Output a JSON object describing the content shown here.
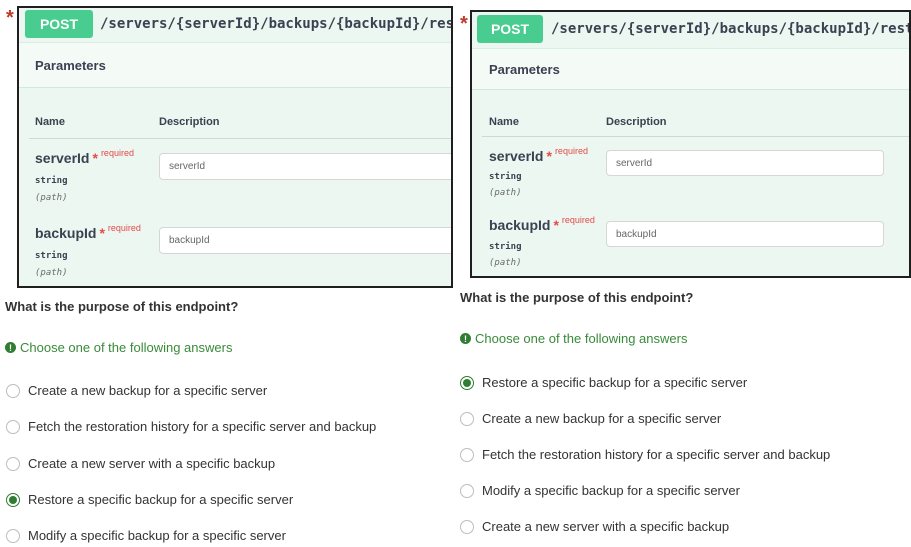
{
  "colors": {
    "post": "#49cc90",
    "required": "#e64a4a",
    "hint": "#3a8a3a",
    "selected_radio": "#2e7d32"
  },
  "icons": {
    "hint": "exclamation-circle-icon",
    "marker": "asterisk-icon"
  },
  "left": {
    "marker": "*",
    "method": "POST",
    "path": "/servers/{serverId}/backups/{backupId}/restore",
    "parameters_title": "Parameters",
    "col_name": "Name",
    "col_description": "Description",
    "params": [
      {
        "name": "serverId",
        "star": "*",
        "required": "required",
        "type": "string",
        "in": "(path)",
        "placeholder": "serverId"
      },
      {
        "name": "backupId",
        "star": "*",
        "required": "required",
        "type": "string",
        "in": "(path)",
        "placeholder": "backupId"
      }
    ],
    "question": "What is the purpose of this endpoint?",
    "hint": "Choose one of the following answers",
    "options": [
      {
        "label": "Create a new backup for a specific server",
        "selected": false
      },
      {
        "label": "Fetch the restoration history for a specific server and backup",
        "selected": false
      },
      {
        "label": "Create a new server with a specific backup",
        "selected": false
      },
      {
        "label": "Restore a specific backup for a specific server",
        "selected": true
      },
      {
        "label": "Modify a specific backup for a specific server",
        "selected": false
      }
    ]
  },
  "right": {
    "marker": "*",
    "method": "POST",
    "path": "/servers/{serverId}/backups/{backupId}/restoration",
    "parameters_title": "Parameters",
    "col_name": "Name",
    "col_description": "Description",
    "params": [
      {
        "name": "serverId",
        "star": "*",
        "required": "required",
        "type": "string",
        "in": "(path)",
        "placeholder": "serverId"
      },
      {
        "name": "backupId",
        "star": "*",
        "required": "required",
        "type": "string",
        "in": "(path)",
        "placeholder": "backupId"
      }
    ],
    "question": "What is the purpose of this endpoint?",
    "hint": "Choose one of the following answers",
    "options": [
      {
        "label": "Restore a specific backup for a specific server",
        "selected": true
      },
      {
        "label": "Create a new backup for a specific server",
        "selected": false
      },
      {
        "label": "Fetch the restoration history for a specific server and backup",
        "selected": false
      },
      {
        "label": "Modify a specific backup for a specific server",
        "selected": false
      },
      {
        "label": "Create a new server with a specific backup",
        "selected": false
      }
    ]
  }
}
